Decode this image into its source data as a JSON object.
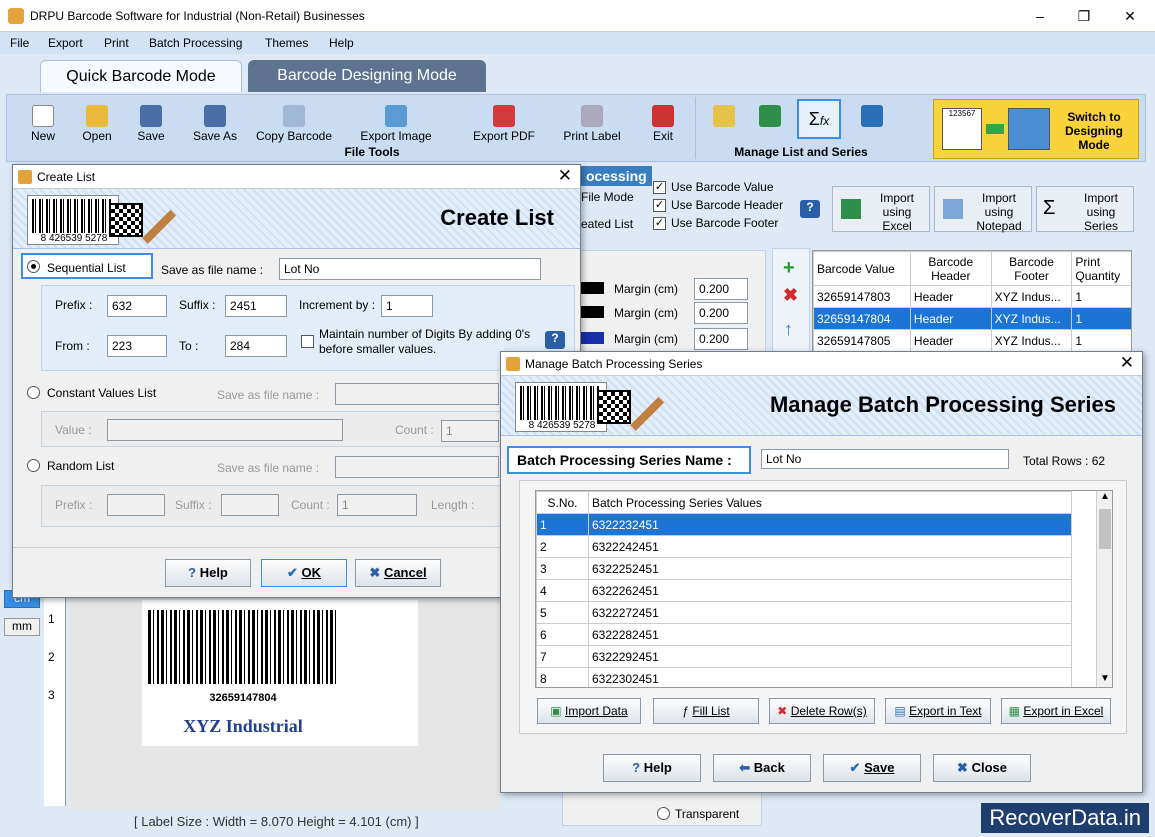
{
  "app": {
    "title": "DRPU Barcode Software for Industrial (Non-Retail) Businesses"
  },
  "menu": [
    "File",
    "Export",
    "Print",
    "Batch Processing",
    "Themes",
    "Help"
  ],
  "tabs": {
    "quick": "Quick Barcode Mode",
    "designing": "Barcode Designing Mode"
  },
  "ribbon": {
    "file_tools": [
      "New",
      "Open",
      "Save",
      "Save As",
      "Copy Barcode",
      "Export Image",
      "Export PDF",
      "Print Label",
      "Exit"
    ],
    "file_tools_label": "File Tools",
    "manage_label": "Manage List and Series",
    "switch": "Switch to Designing Mode",
    "switch_img_num": "123567"
  },
  "batch": {
    "heading": "ocessing",
    "file_mode": "File Mode",
    "created_list": "eated List",
    "use_value": "Use Barcode Value",
    "use_header": "Use Barcode Header",
    "use_footer": "Use Barcode Footer",
    "import_excel": "Import using Excel",
    "import_notepad": "Import using Notepad",
    "import_series": "Import using Series"
  },
  "main_table": {
    "headers": [
      "Barcode Value",
      "Barcode Header",
      "Barcode Footer",
      "Print Quantity"
    ],
    "rows": [
      [
        "32659147803",
        "Header",
        "XYZ Indus...",
        "1"
      ],
      [
        "32659147804",
        "Header",
        "XYZ Indus...",
        "1"
      ],
      [
        "32659147805",
        "Header",
        "XYZ Indus...",
        "1"
      ]
    ]
  },
  "margins": {
    "label": "Margin (cm)",
    "v1": "0.200",
    "v2": "0.200",
    "v3": "0.200"
  },
  "preview": {
    "barcode_value": "32659147804",
    "footer": "XYZ Industrial",
    "ruler": [
      "1",
      "2",
      "3"
    ],
    "units": [
      "cm",
      "mm"
    ]
  },
  "status": "[ Label Size : Width = 8.070  Height = 4.101 (cm) ]",
  "transparent": "Transparent",
  "create_list": {
    "title": "Create List",
    "banner": "Create List",
    "barcode_num": "8 426539 5278",
    "sequential": "Sequential List",
    "save_as": "Save as file name :",
    "file_value": "Lot No",
    "prefix": "Prefix :",
    "prefix_v": "632",
    "suffix": "Suffix :",
    "suffix_v": "2451",
    "increment": "Increment by :",
    "increment_v": "1",
    "from": "From :",
    "from_v": "223",
    "to": "To :",
    "to_v": "284",
    "maintain": "Maintain number of Digits By adding 0's before smaller values.",
    "constant": "Constant Values List",
    "value": "Value :",
    "count": "Count :",
    "count_v": "1",
    "random": "Random List",
    "length": "Length :",
    "help": "Help",
    "ok": "OK",
    "cancel": "Cancel"
  },
  "manage": {
    "title": "Manage Batch Processing Series",
    "banner": "Manage Batch Processing Series",
    "barcode_num": "8 426539 5278",
    "name_label": "Batch Processing Series Name :",
    "name_value": "Lot No",
    "total": "Total Rows : 62",
    "col_sno": "S.No.",
    "col_values": "Batch Processing Series Values",
    "rows": [
      [
        "1",
        "6322232451"
      ],
      [
        "2",
        "6322242451"
      ],
      [
        "3",
        "6322252451"
      ],
      [
        "4",
        "6322262451"
      ],
      [
        "5",
        "6322272451"
      ],
      [
        "6",
        "6322282451"
      ],
      [
        "7",
        "6322292451"
      ],
      [
        "8",
        "6322302451"
      ]
    ],
    "import": "Import Data",
    "fill": "Fill List",
    "delete": "Delete Row(s)",
    "export_text": "Export in Text",
    "export_excel": "Export in Excel",
    "help": "Help",
    "back": "Back",
    "save": "Save",
    "close": "Close"
  },
  "watermark": "RecoverData.in"
}
